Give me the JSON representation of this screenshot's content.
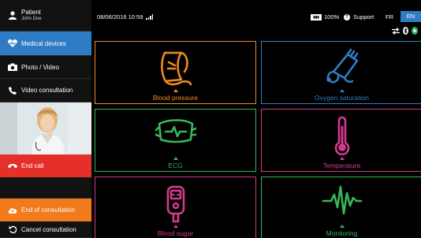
{
  "patient": {
    "label": "Patient",
    "name": "John Doe"
  },
  "sidebar": {
    "medical_devices": "Medical devices",
    "photo_video": "Photo / Video",
    "video_consultation": "Video consultation",
    "end_call": "End call",
    "end_consultation": "End of consultation",
    "cancel_consultation": "Cancel consultation"
  },
  "status": {
    "datetime": "08/06/2016 10:59",
    "battery_label": "100%",
    "support": "Support",
    "lang_fr": "FR",
    "lang_en": "EN"
  },
  "tiles": [
    {
      "label": "Blood pressure",
      "color": "#f08a24",
      "icon": "blood-pressure-cuff-icon"
    },
    {
      "label": "Oxygen saturation",
      "color": "#2e7cc4",
      "icon": "pulse-oximeter-icon"
    },
    {
      "label": "ECG",
      "color": "#38b55a",
      "icon": "ecg-device-icon"
    },
    {
      "label": "Temperature",
      "color": "#d23b8e",
      "icon": "thermometer-icon"
    },
    {
      "label": "Blood sugar",
      "color": "#d23b8e",
      "icon": "glucometer-icon"
    },
    {
      "label": "Monitoring",
      "color": "#38b55a",
      "icon": "heartbeat-icon"
    }
  ],
  "colors": {
    "accent_blue": "#2e7cc4",
    "end_call_red": "#e52f2a",
    "end_consultation_orange": "#f07a1c"
  }
}
